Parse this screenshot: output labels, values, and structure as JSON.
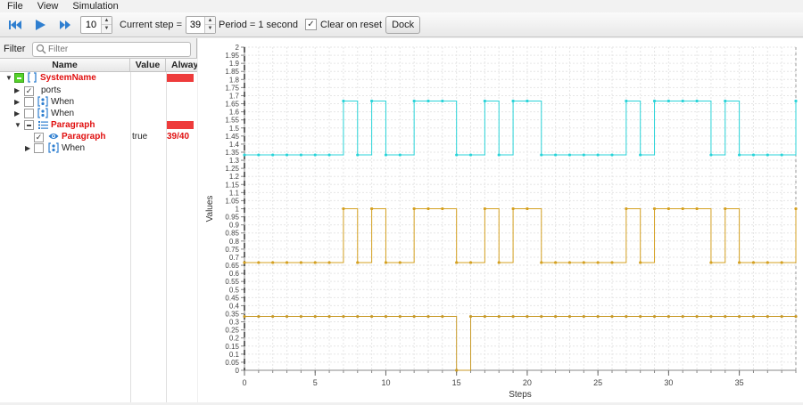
{
  "menu": [
    "File",
    "View",
    "Simulation"
  ],
  "toolbar": {
    "steps_value": "10",
    "current_step_label": "Current step =",
    "current_step_value": "39",
    "period_label": "Period = 1 second",
    "clear_on_reset_label": "Clear on reset",
    "clear_on_reset_checked": true,
    "dock_label": "Dock"
  },
  "filter": {
    "label": "Filter",
    "placeholder": "Filter"
  },
  "table": {
    "columns": [
      "Name",
      "Value",
      "Always"
    ],
    "rows": [
      {
        "name": "SystemName",
        "value": "",
        "always": "",
        "red": true,
        "bar": true
      },
      {
        "name": "ports",
        "value": "",
        "always": "",
        "red": false,
        "bar": false
      },
      {
        "name": "When",
        "value": "",
        "always": "",
        "red": false,
        "bar": false
      },
      {
        "name": "When",
        "value": "",
        "always": "",
        "red": false,
        "bar": false
      },
      {
        "name": "Paragraph",
        "value": "",
        "always": "",
        "red": true,
        "bar": true
      },
      {
        "name": "Paragraph",
        "value": "true",
        "always": "39/40",
        "red": true,
        "bar": false
      },
      {
        "name": "When",
        "value": "",
        "always": "",
        "red": false,
        "bar": false
      }
    ]
  },
  "chart_data": {
    "type": "line",
    "step": true,
    "xlabel": "Steps",
    "ylabel": "Values",
    "xlim": [
      0,
      39
    ],
    "ylim": [
      0,
      2
    ],
    "x_ticks": [
      0,
      5,
      10,
      15,
      20,
      25,
      30,
      35
    ],
    "y_ticks": [
      "0",
      "0.05",
      "0.1",
      "0.15",
      "0.2",
      "0.25",
      "0.3",
      "0.35",
      "0.4",
      "0.45",
      "0.5",
      "0.55",
      "0.6",
      "0.65",
      "0.7",
      "0.75",
      "0.8",
      "0.85",
      "0.9",
      "0.95",
      "1",
      "1.05",
      "1.1",
      "1.15",
      "1.2",
      "1.25",
      "1.3",
      "1.35",
      "1.4",
      "1.45",
      "1.5",
      "1.55",
      "1.6",
      "1.65",
      "1.7",
      "1.75",
      "1.8",
      "1.85",
      "1.9",
      "1.95",
      "2"
    ],
    "grid": true,
    "series": [
      {
        "color": "#29d3d8",
        "values": [
          1.333,
          1.333,
          1.333,
          1.333,
          1.333,
          1.333,
          1.333,
          1.667,
          1.333,
          1.667,
          1.333,
          1.333,
          1.667,
          1.667,
          1.667,
          1.333,
          1.333,
          1.667,
          1.333,
          1.667,
          1.667,
          1.333,
          1.333,
          1.333,
          1.333,
          1.333,
          1.333,
          1.667,
          1.333,
          1.667,
          1.667,
          1.667,
          1.667,
          1.333,
          1.667,
          1.333,
          1.333,
          1.333,
          1.333,
          1.667
        ]
      },
      {
        "color": "#d4a020",
        "values": [
          0.667,
          0.667,
          0.667,
          0.667,
          0.667,
          0.667,
          0.667,
          1.0,
          0.667,
          1.0,
          0.667,
          0.667,
          1.0,
          1.0,
          1.0,
          0.667,
          0.667,
          1.0,
          0.667,
          1.0,
          1.0,
          0.667,
          0.667,
          0.667,
          0.667,
          0.667,
          0.667,
          1.0,
          0.667,
          1.0,
          1.0,
          1.0,
          1.0,
          0.667,
          1.0,
          0.667,
          0.667,
          0.667,
          0.667,
          1.0
        ]
      },
      {
        "color": "#c89a28",
        "values": [
          0.333,
          0.333,
          0.333,
          0.333,
          0.333,
          0.333,
          0.333,
          0.333,
          0.333,
          0.333,
          0.333,
          0.333,
          0.333,
          0.333,
          0.333,
          0.0,
          0.333,
          0.333,
          0.333,
          0.333,
          0.333,
          0.333,
          0.333,
          0.333,
          0.333,
          0.333,
          0.333,
          0.333,
          0.333,
          0.333,
          0.333,
          0.333,
          0.333,
          0.333,
          0.333,
          0.333,
          0.333,
          0.333,
          0.333,
          0.333
        ]
      }
    ]
  }
}
